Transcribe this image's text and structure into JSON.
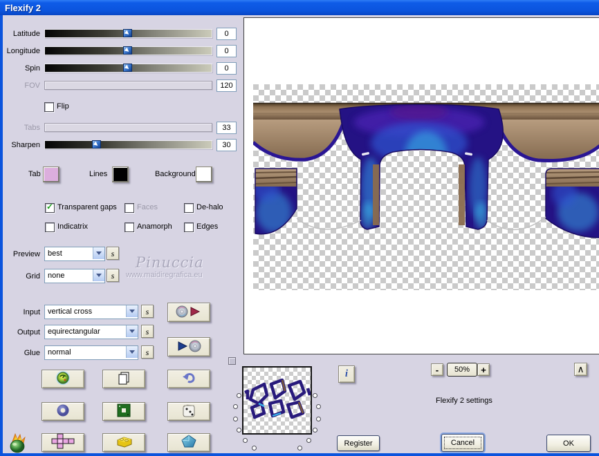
{
  "window": {
    "title": "Flexify 2"
  },
  "sliders": [
    {
      "label": "Latitude",
      "value": "0",
      "pos": 50,
      "enabled": true
    },
    {
      "label": "Longitude",
      "value": "0",
      "pos": 50,
      "enabled": true
    },
    {
      "label": "Spin",
      "value": "0",
      "pos": 50,
      "enabled": true
    },
    {
      "label": "FOV",
      "value": "120",
      "pos": null,
      "enabled": false
    },
    {
      "label": "Tabs",
      "value": "33",
      "pos": null,
      "enabled": false
    },
    {
      "label": "Sharpen",
      "value": "30",
      "pos": 30,
      "enabled": true
    }
  ],
  "flip": {
    "label": "Flip",
    "checked": false
  },
  "swatches": [
    {
      "label": "Tab",
      "color": "#dcaedd"
    },
    {
      "label": "Lines",
      "color": "#000000"
    },
    {
      "label": "Background",
      "color": "#ffffff"
    }
  ],
  "checkboxes": [
    {
      "label": "Transparent gaps",
      "checked": true,
      "enabled": true
    },
    {
      "label": "Faces",
      "checked": false,
      "enabled": false
    },
    {
      "label": "De-halo",
      "checked": false,
      "enabled": true
    },
    {
      "label": "Indicatrix",
      "checked": false,
      "enabled": true
    },
    {
      "label": "Anamorph",
      "checked": false,
      "enabled": true
    },
    {
      "label": "Edges",
      "checked": false,
      "enabled": true
    }
  ],
  "dropdowns": [
    {
      "label": "Preview",
      "value": "best"
    },
    {
      "label": "Grid",
      "value": "none"
    },
    {
      "label": "Input",
      "value": "vertical cross"
    },
    {
      "label": "Output",
      "value": "equirectangular"
    },
    {
      "label": "Glue",
      "value": "normal"
    }
  ],
  "s_button": "s",
  "watermark": {
    "name": "Pinuccia",
    "url": "www.maidiregrafica.eu"
  },
  "preview_zoom": {
    "minus": "-",
    "level": "50%",
    "plus": "+",
    "collapse": "∧"
  },
  "status_text": "Flexify 2 settings",
  "action_buttons": {
    "info": "i",
    "register": "Register",
    "cancel": "Cancel",
    "ok": "OK"
  },
  "icons": {
    "save_settings": "cd-with-red-play-triangle",
    "load_settings": "blue-play-triangle-with-cd",
    "swirl_logo": "green-yellow-swirl",
    "copy": "stacked-pages",
    "undo": "curved-back-arrow",
    "ring": "blue-donut",
    "frame": "green-square-frame",
    "dice": "white-die",
    "cross_layout": "pink-unfolded-cube-cross",
    "brick": "yellow-brick",
    "gem": "blue-pentagon-gem",
    "flame": "flaming-pear-logo",
    "info": "letter-i"
  },
  "colors": {
    "titlebar": "#0b54dd",
    "dialog_bg": "#d7d4e3",
    "button_face": "#ece9d8",
    "accent_blue": "#7f9db9"
  }
}
